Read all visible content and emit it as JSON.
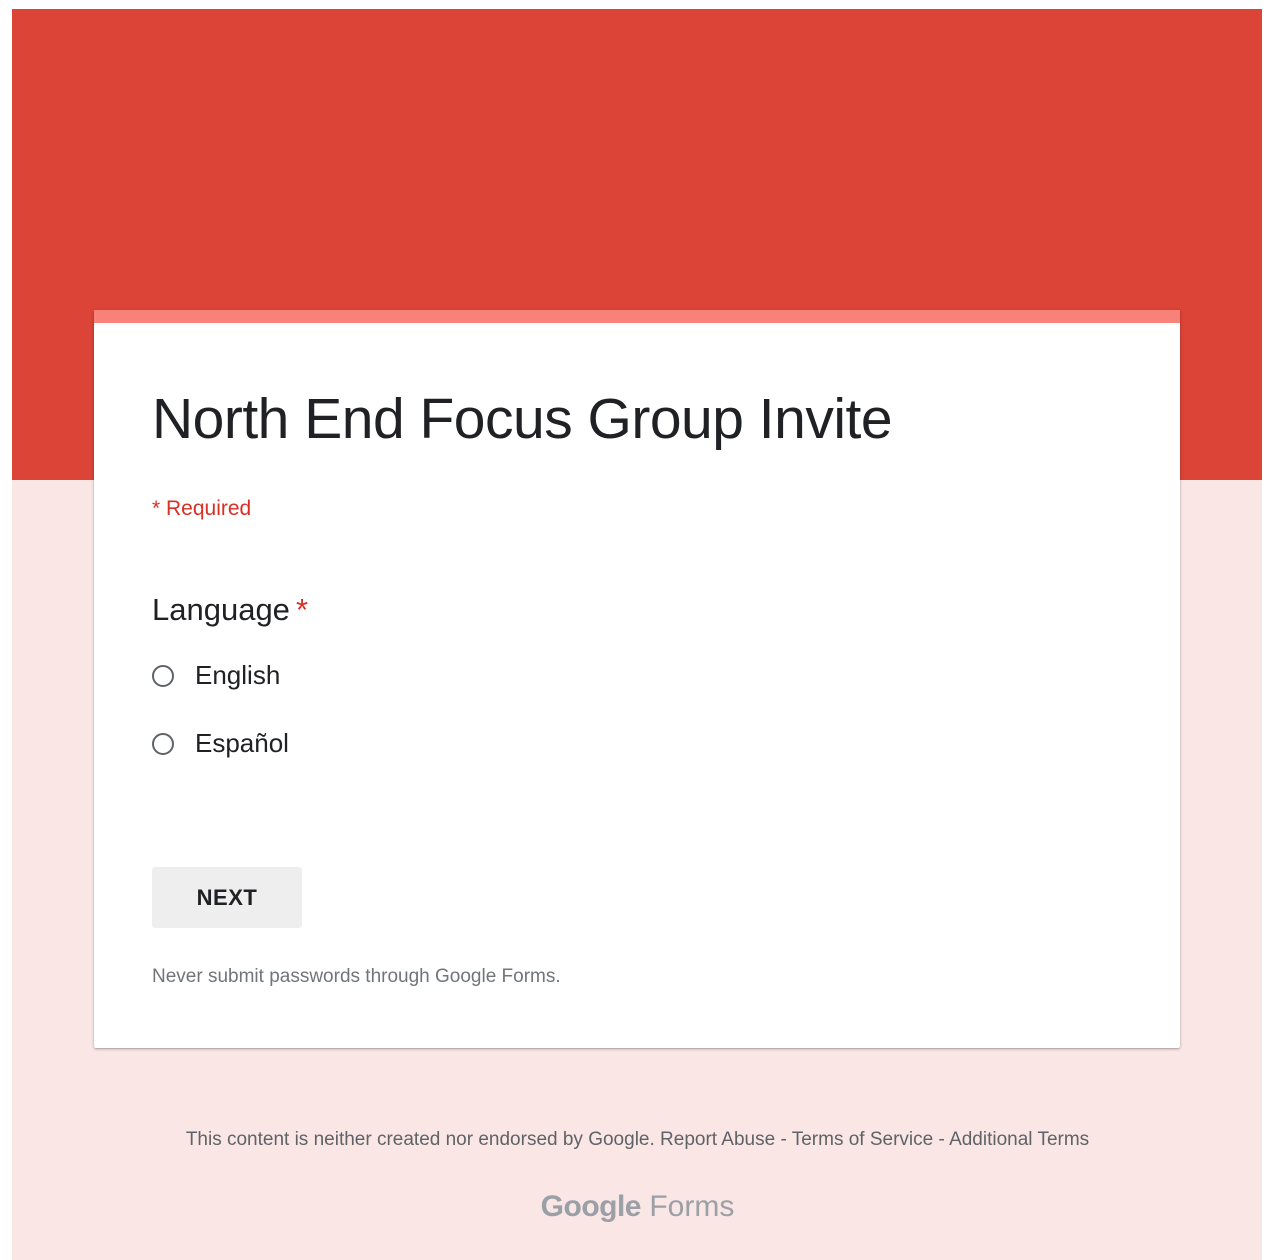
{
  "colors": {
    "header": "#db4437",
    "page_background": "#fae6e5",
    "card_stripe": "#f8827a",
    "required": "#d93025"
  },
  "form": {
    "title": "North End Focus Group Invite",
    "required_note": "* Required"
  },
  "question": {
    "title": "Language",
    "required_mark": "*",
    "options": [
      {
        "label": "English",
        "selected": false
      },
      {
        "label": "Español",
        "selected": false
      }
    ]
  },
  "buttons": {
    "next_label": "NEXT"
  },
  "warning": "Never submit passwords through Google Forms.",
  "footer": {
    "disclaimer": "This content is neither created nor endorsed by Google.",
    "report_abuse": "Report Abuse",
    "separator": " - ",
    "terms_of_service": "Terms of Service",
    "additional_terms": "Additional Terms",
    "logo_google": "Google",
    "logo_forms": "Forms"
  },
  "icons": {
    "radio": "radio-unchecked-icon"
  }
}
